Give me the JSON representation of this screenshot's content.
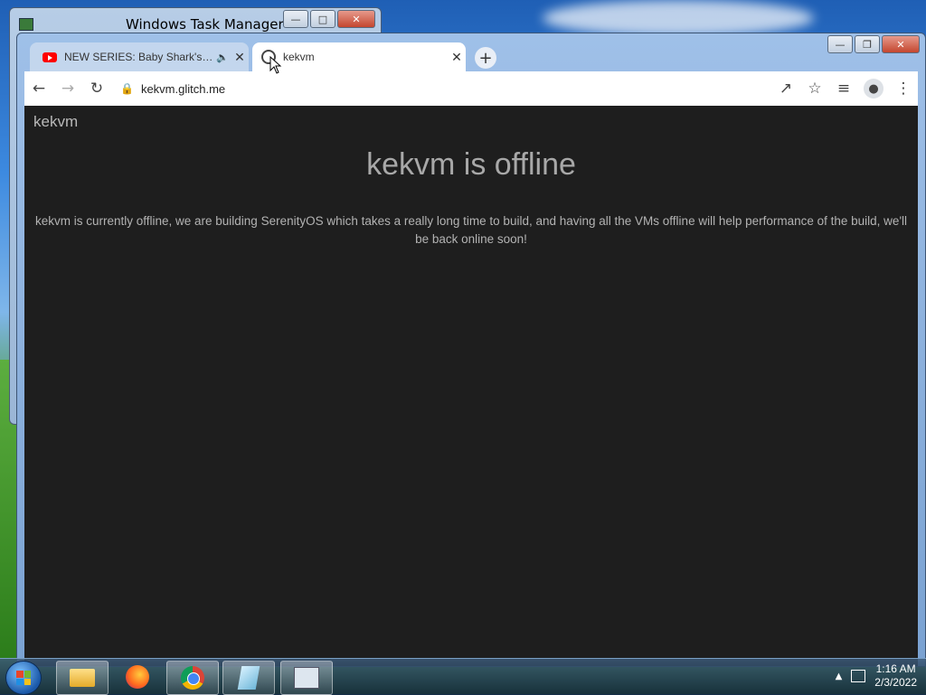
{
  "taskmanager": {
    "title": "Windows Task Manager"
  },
  "browser": {
    "tabs": [
      {
        "title": "NEW SERIES: Baby Shark's Bi",
        "favicon": "youtube-icon",
        "audio": "speaker-icon"
      },
      {
        "title": "kekvm",
        "favicon": "globe-icon"
      }
    ],
    "new_tab_label": "+",
    "address": "kekvm.glitch.me"
  },
  "page": {
    "brand": "kekvm",
    "heading": "kekvm is offline",
    "message": "kekvm is currently offline, we are building SerenityOS which takes a really long time to build, and having all the VMs offline will help performance of the build, we'll be back online soon!",
    "background_color": "#1e1e1e",
    "text_color": "#a8a8a8"
  },
  "taskbar": {
    "apps": [
      "windows-explorer",
      "firefox",
      "google-chrome",
      "notepad",
      "task-manager"
    ],
    "time": "1:16 AM",
    "date": "2/3/2022"
  }
}
